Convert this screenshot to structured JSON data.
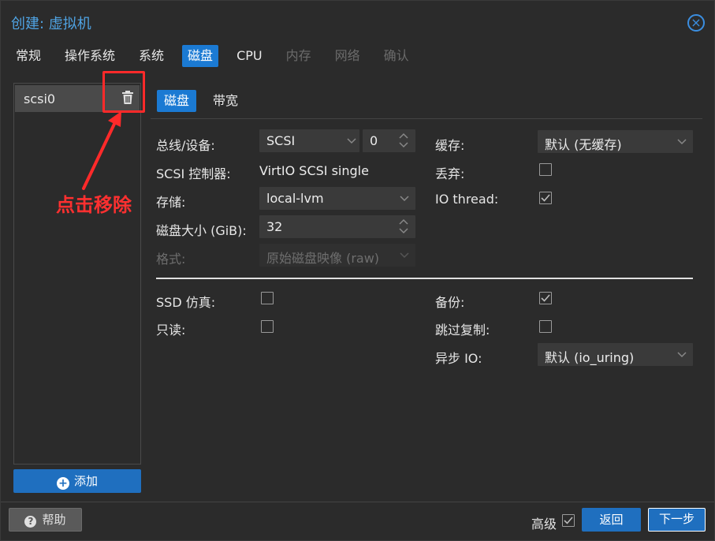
{
  "window": {
    "title": "创建: 虚拟机"
  },
  "tabs": [
    {
      "label": "常规",
      "state": "normal"
    },
    {
      "label": "操作系统",
      "state": "normal"
    },
    {
      "label": "系统",
      "state": "normal"
    },
    {
      "label": "磁盘",
      "state": "active"
    },
    {
      "label": "CPU",
      "state": "normal"
    },
    {
      "label": "内存",
      "state": "disabled"
    },
    {
      "label": "网络",
      "state": "disabled"
    },
    {
      "label": "确认",
      "state": "disabled"
    }
  ],
  "devices": [
    {
      "label": "scsi0"
    }
  ],
  "annotation": {
    "text": "点击移除",
    "color": "#ff2a2a"
  },
  "add_button": {
    "label": "添加"
  },
  "sub_tabs": [
    {
      "label": "磁盘",
      "active": true
    },
    {
      "label": "带宽",
      "active": false
    }
  ],
  "form": {
    "bus_label": "总线/设备:",
    "bus_value": "SCSI",
    "device_index": "0",
    "controller_label": "SCSI 控制器:",
    "controller_value": "VirtIO SCSI single",
    "storage_label": "存储:",
    "storage_value": "local-lvm",
    "size_label": "磁盘大小 (GiB):",
    "size_value": "32",
    "format_label": "格式:",
    "format_value": "原始磁盘映像 (raw)",
    "cache_label": "缓存:",
    "cache_value": "默认 (无缓存)",
    "discard_label": "丢弃:",
    "discard_checked": false,
    "iothread_label": "IO thread:",
    "iothread_checked": true,
    "ssd_label": "SSD 仿真:",
    "ssd_checked": false,
    "readonly_label": "只读:",
    "readonly_checked": false,
    "backup_label": "备份:",
    "backup_checked": true,
    "skip_replication_label": "跳过复制:",
    "skip_replication_checked": false,
    "async_io_label": "异步 IO:",
    "async_io_value": "默认 (io_uring)"
  },
  "footer": {
    "help_label": "帮助",
    "advanced_label": "高级",
    "advanced_checked": true,
    "back_label": "返回",
    "next_label": "下一步"
  },
  "colors": {
    "accent": "#1b7ad3",
    "title": "#4fa3e3",
    "annotation": "#ff2a2a"
  }
}
